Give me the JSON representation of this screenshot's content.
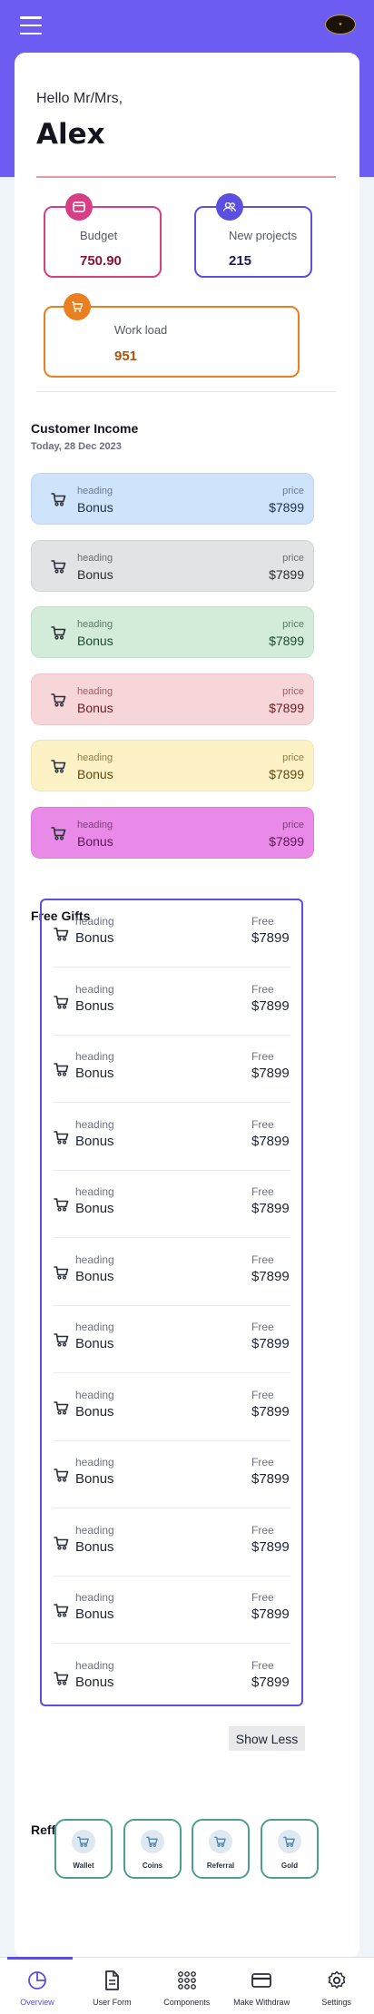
{
  "header": {
    "menu_icon": "hamburger-icon",
    "logo_icon": "brand-logo"
  },
  "profile": {
    "greeting": "Hello Mr/Mrs,",
    "name": "Alex"
  },
  "stats": {
    "budget": {
      "label": "Budget",
      "value": "750.90",
      "icon": "card-icon",
      "color": "#d63f86"
    },
    "projects": {
      "label": "New projects",
      "value": "215",
      "icon": "users-icon",
      "color": "#5a4fe0"
    },
    "workload": {
      "label": "Work load",
      "value": "951",
      "icon": "cart-icon",
      "color": "#ea7f1f"
    }
  },
  "income": {
    "title": "Customer Income",
    "date": "Today, 28 Dec 2023",
    "items": [
      {
        "heading": "heading",
        "title": "Bonus",
        "price_label": "price",
        "price": "$7899",
        "bg": "#cfe3fb",
        "text": "#1d2f4a",
        "sub": "#6a7a90",
        "border": "#bcd6f5"
      },
      {
        "heading": "heading",
        "title": "Bonus",
        "price_label": "price",
        "price": "$7899",
        "bg": "#e2e3e5",
        "text": "#2b2d31",
        "sub": "#6c6e73",
        "border": "#d3d4d7"
      },
      {
        "heading": "heading",
        "title": "Bonus",
        "price_label": "price",
        "price": "$7899",
        "bg": "#d3ebd9",
        "text": "#1e4a2a",
        "sub": "#5b7d63",
        "border": "#c3e0cb"
      },
      {
        "heading": "heading",
        "title": "Bonus",
        "price_label": "price",
        "price": "$7899",
        "bg": "#f7d6d9",
        "text": "#6a1c24",
        "sub": "#9a6066",
        "border": "#eec6cb"
      },
      {
        "heading": "heading",
        "title": "Bonus",
        "price_label": "price",
        "price": "$7899",
        "bg": "#fcf2c6",
        "text": "#5e4a10",
        "sub": "#8f7e4a",
        "border": "#f2e6b0"
      },
      {
        "heading": "heading",
        "title": "Bonus",
        "price_label": "price",
        "price": "$7899",
        "bg": "#ea8ae8",
        "text": "#5c1458",
        "sub": "#7f3c7c",
        "border": "#df7cdc"
      }
    ]
  },
  "gifts": {
    "title": "Free Gifts",
    "items": [
      {
        "heading": "heading",
        "title": "Bonus",
        "free_label": "Free",
        "price": "$7899"
      },
      {
        "heading": "heading",
        "title": "Bonus",
        "free_label": "Free",
        "price": "$7899"
      },
      {
        "heading": "heading",
        "title": "Bonus",
        "free_label": "Free",
        "price": "$7899"
      },
      {
        "heading": "heading",
        "title": "Bonus",
        "free_label": "Free",
        "price": "$7899"
      },
      {
        "heading": "heading",
        "title": "Bonus",
        "free_label": "Free",
        "price": "$7899"
      },
      {
        "heading": "heading",
        "title": "Bonus",
        "free_label": "Free",
        "price": "$7899"
      },
      {
        "heading": "heading",
        "title": "Bonus",
        "free_label": "Free",
        "price": "$7899"
      },
      {
        "heading": "heading",
        "title": "Bonus",
        "free_label": "Free",
        "price": "$7899"
      },
      {
        "heading": "heading",
        "title": "Bonus",
        "free_label": "Free",
        "price": "$7899"
      },
      {
        "heading": "heading",
        "title": "Bonus",
        "free_label": "Free",
        "price": "$7899"
      },
      {
        "heading": "heading",
        "title": "Bonus",
        "free_label": "Free",
        "price": "$7899"
      },
      {
        "heading": "heading",
        "title": "Bonus",
        "free_label": "Free",
        "price": "$7899"
      }
    ],
    "show_less": "Show Less"
  },
  "referrals": {
    "title": "Refferals",
    "items": [
      {
        "label": "Wallet",
        "icon": "cart-icon"
      },
      {
        "label": "Coins",
        "icon": "cart-icon"
      },
      {
        "label": "Referral",
        "icon": "cart-icon"
      },
      {
        "label": "Gold",
        "icon": "cart-icon"
      }
    ]
  },
  "nav": {
    "items": [
      {
        "label": "Overview",
        "icon": "pie-chart-icon",
        "active": true
      },
      {
        "label": "User Form",
        "icon": "document-icon"
      },
      {
        "label": "Components",
        "icon": "grid-dots-icon"
      },
      {
        "label": "Make Withdraw",
        "icon": "card-icon"
      },
      {
        "label": "Settings",
        "icon": "gear-icon"
      }
    ],
    "accent": "#5a4fe0"
  },
  "theme": {
    "primary": "#6c5cf2",
    "background": "#eef4f8"
  }
}
